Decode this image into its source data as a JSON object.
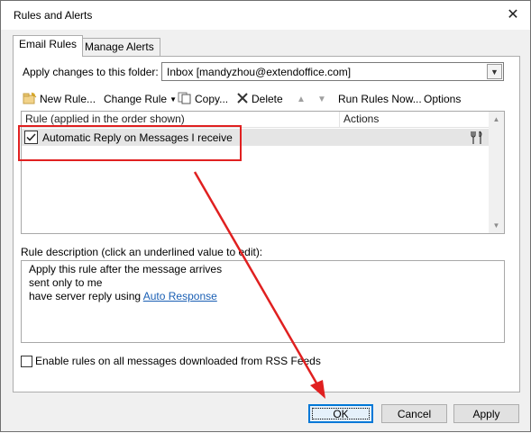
{
  "window": {
    "title": "Rules and Alerts"
  },
  "tabs": [
    {
      "label": "Email Rules"
    },
    {
      "label": "Manage Alerts"
    }
  ],
  "folder": {
    "label": "Apply changes to this folder:",
    "value": "Inbox [mandyzhou@extendoffice.com]"
  },
  "toolbar": {
    "new_rule": "New Rule...",
    "change_rule": "Change Rule",
    "copy": "Copy...",
    "delete": "Delete",
    "run_rules_now": "Run Rules Now...",
    "options": "Options"
  },
  "rules_table": {
    "columns": [
      "Rule (applied in the order shown)",
      "Actions"
    ],
    "rows": [
      {
        "name": "Automatic Reply on Messages I receive",
        "enabled": true
      }
    ]
  },
  "description": {
    "label": "Rule description (click an underlined value to edit):",
    "line1": "Apply this rule after the message arrives",
    "line2": "sent only to me",
    "line3_prefix": "have server reply using ",
    "line3_link": "Auto Response"
  },
  "rss": {
    "label": "Enable rules on all messages downloaded from RSS Feeds",
    "checked": false
  },
  "buttons": {
    "ok": "OK",
    "cancel": "Cancel",
    "apply": "Apply"
  },
  "colors": {
    "annotation": "#e02020",
    "link": "#1a5fb4",
    "focus": "#0078d7"
  }
}
